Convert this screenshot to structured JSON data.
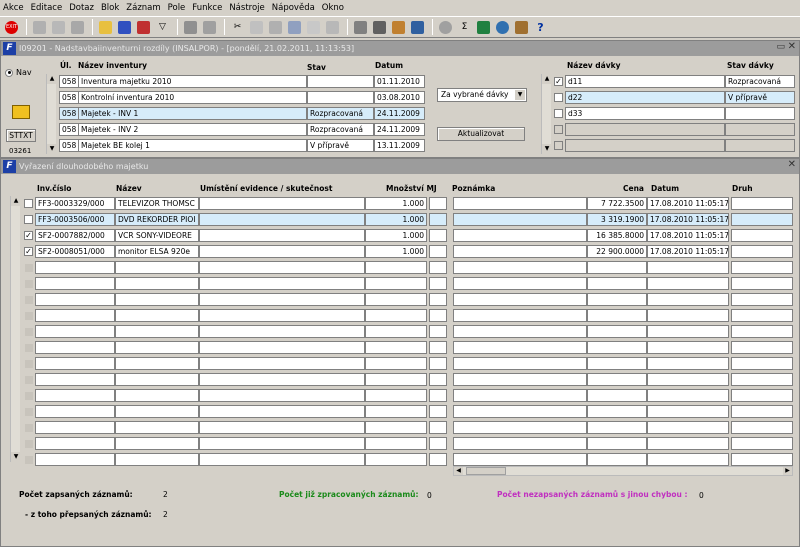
{
  "menu": [
    "Akce",
    "Editace",
    "Dotaz",
    "Blok",
    "Záznam",
    "Pole",
    "Funkce",
    "Nástroje",
    "Nápověda",
    "Okno"
  ],
  "top_window": {
    "title": "I09201 - Nadstavbaiinventurni rozdíly (INSALPOR) - [pondělí, 21.02.2011, 11:13:53]",
    "nav_label": "Nav",
    "side_btn1": "STTXT",
    "side_btn2": "03261",
    "headers": {
      "ul": "Úl.",
      "nazev": "Název inventury",
      "stav": "Stav",
      "datum": "Datum"
    },
    "rows": [
      {
        "ul": "058",
        "nazev": "Inventura majetku 2010",
        "stav": "",
        "datum": "01.11.2010"
      },
      {
        "ul": "058",
        "nazev": "Kontrolní inventura 2010",
        "stav": "",
        "datum": "03.08.2010"
      },
      {
        "ul": "058",
        "nazev": "Majetek - INV 1",
        "stav": "Rozpracovaná",
        "datum": "24.11.2009"
      },
      {
        "ul": "058",
        "nazev": "Majetek - INV 2",
        "stav": "Rozpracovaná",
        "datum": "24.11.2009"
      },
      {
        "ul": "058",
        "nazev": "Majetek BE kolej 1",
        "stav": "V přípravě",
        "datum": "13.11.2009"
      }
    ],
    "dropdown_value": "Za vybrané dávky",
    "update_button": "Aktualizovat",
    "batch_headers": {
      "nazev": "Název dávky",
      "stav": "Stav dávky"
    },
    "batches": [
      {
        "checked": true,
        "nazev": "d11",
        "stav": "Rozpracovaná"
      },
      {
        "checked": false,
        "nazev": "d22",
        "stav": "V přípravě"
      },
      {
        "checked": false,
        "nazev": "d33",
        "stav": ""
      }
    ]
  },
  "bottom_window": {
    "title": "Vyřazení dlouhodobého majetku",
    "headers": {
      "inv": "Inv.číslo",
      "nazev": "Název",
      "umisteni": "Umístění evidence / skutečnost",
      "mnozstvi": "Množství MJ",
      "poznamka": "Poznámka",
      "cena": "Cena",
      "datum": "Datum",
      "druh": "Druh"
    },
    "rows": [
      {
        "checked": false,
        "inv": "FF3-0003329/000",
        "nazev": "TELEVIZOR THOMSC",
        "mnozstvi": "1.000",
        "cena": "7 722.3500",
        "datum": "17.08.2010 11:05:17"
      },
      {
        "checked": false,
        "inv": "FF3-0003506/000",
        "nazev": "DVD REKORDER PIOI",
        "mnozstvi": "1.000",
        "cena": "3 319.1900",
        "datum": "17.08.2010 11:05:17"
      },
      {
        "checked": true,
        "inv": "SF2-0007882/000",
        "nazev": "VCR SONY-VIDEORE",
        "mnozstvi": "1.000",
        "cena": "16 385.8000",
        "datum": "17.08.2010 11:05:17"
      },
      {
        "checked": true,
        "inv": "SF2-0008051/000",
        "nazev": "monitor ELSA  920e",
        "mnozstvi": "1.000",
        "cena": "22 900.0000",
        "datum": "17.08.2010 11:05:17"
      }
    ],
    "footer": {
      "zapsanych_label": "Počet zapsaných záznamů:",
      "zapsanych_value": "2",
      "zpracovanych_label": "Počet již zpracovaných záznamů:",
      "zpracovanych_value": "0",
      "nezapsanych_label": "Počet nezapsaných záznamů s jinou chybou :",
      "nezapsanych_value": "0",
      "prepsanych_label": "- z toho přepsaných záznamů:",
      "prepsanych_value": "2"
    },
    "colors": {
      "zpracovanych": "#1a8a1a",
      "nezapsanych": "#c030c0",
      "highlight": "#d6ecfa"
    }
  }
}
